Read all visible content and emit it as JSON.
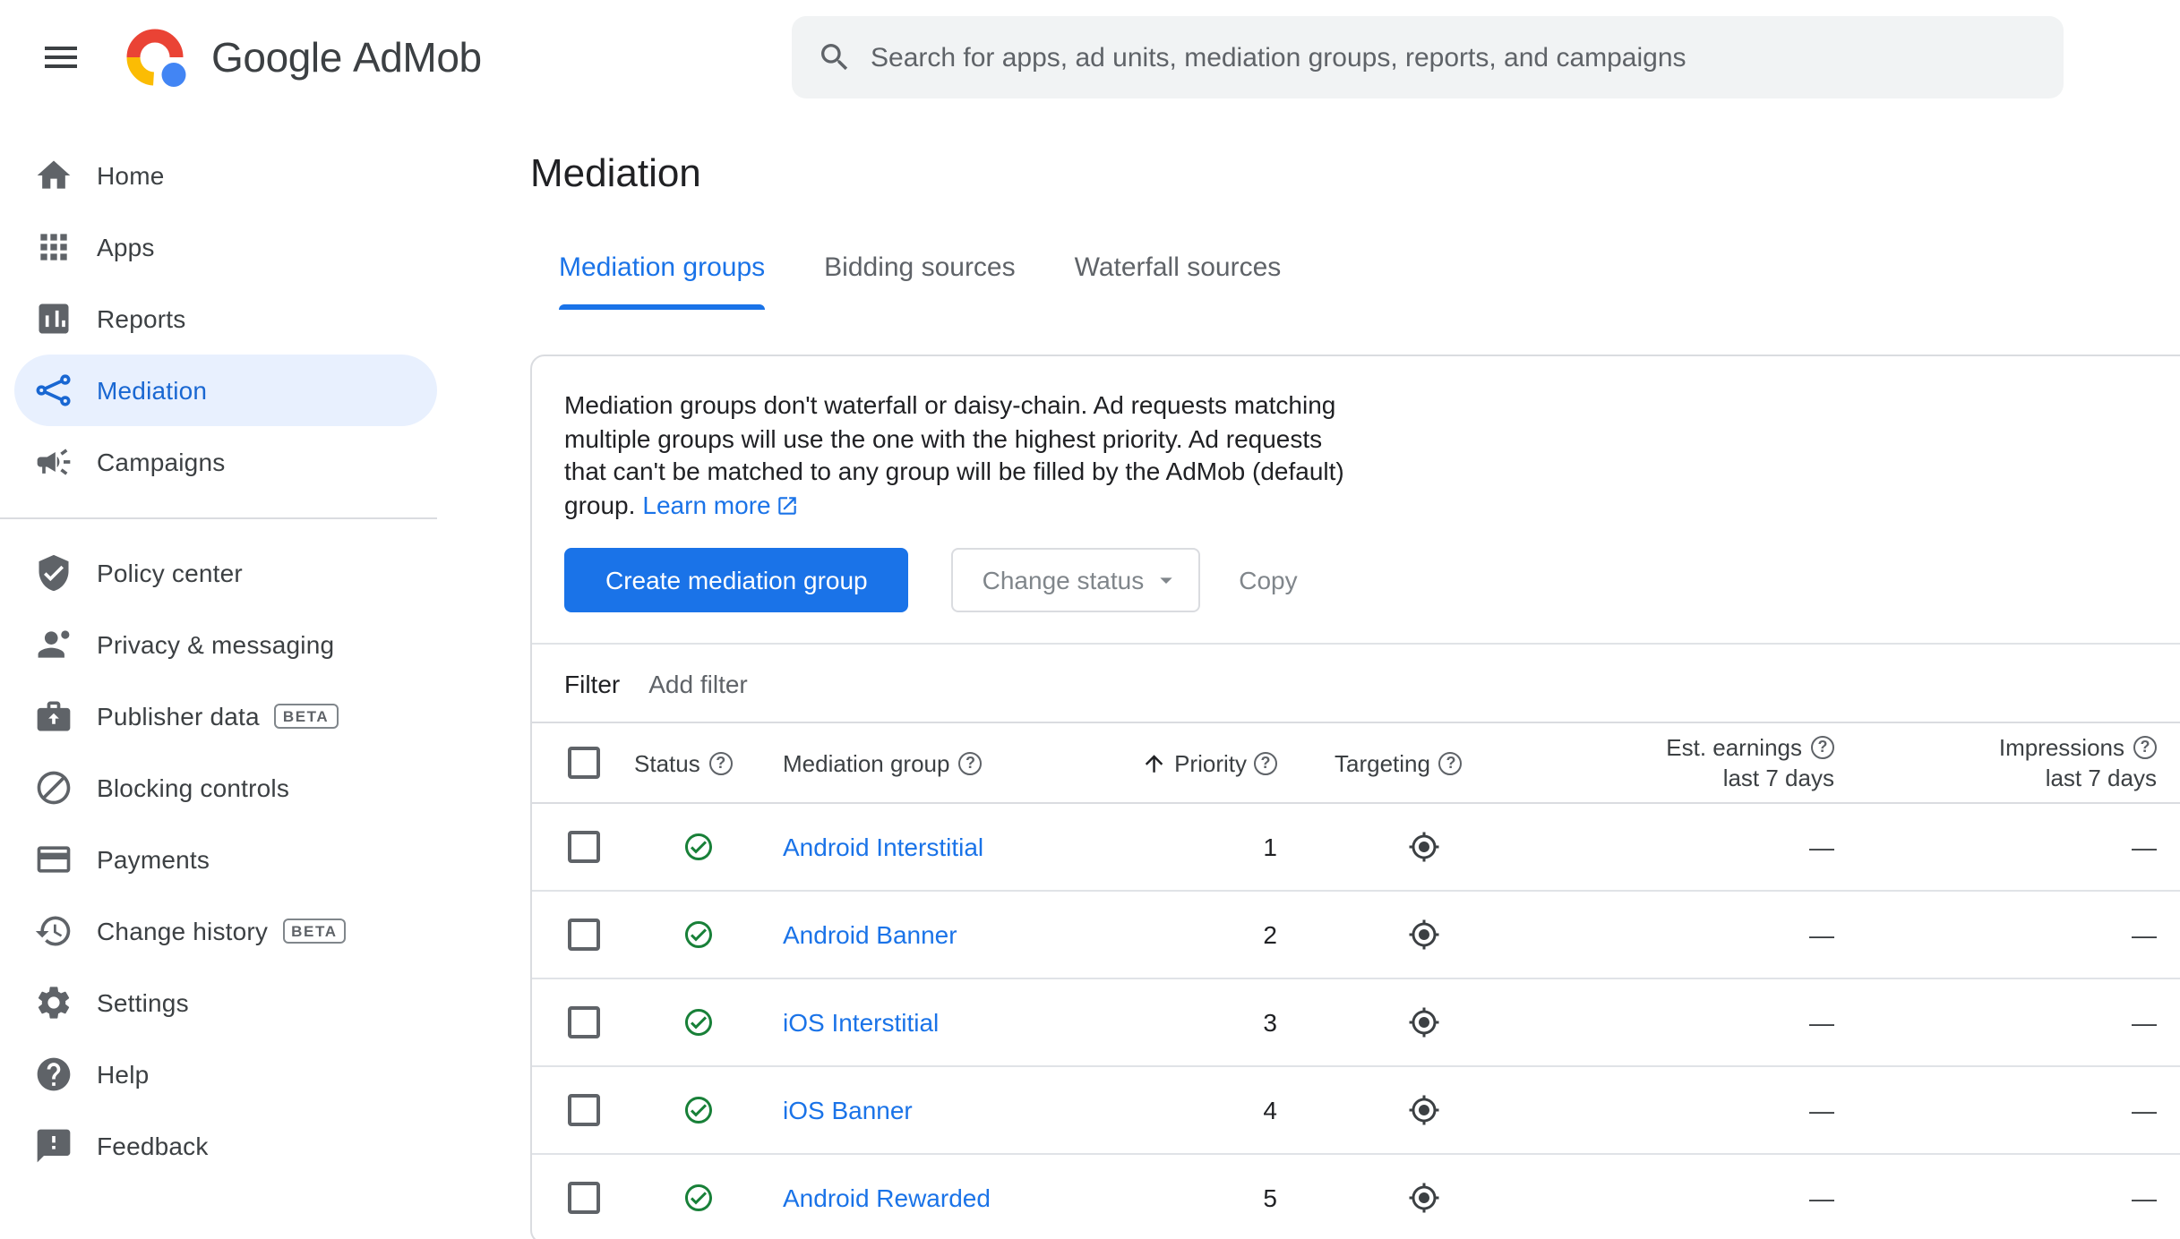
{
  "header": {
    "brand": "Google",
    "product": "AdMob",
    "search_placeholder": "Search for apps, ad units, mediation groups, reports, and campaigns"
  },
  "sidebar": {
    "items": [
      {
        "label": "Home",
        "icon": "home-icon"
      },
      {
        "label": "Apps",
        "icon": "apps-icon"
      },
      {
        "label": "Reports",
        "icon": "reports-icon"
      },
      {
        "label": "Mediation",
        "icon": "mediation-icon",
        "selected": true
      },
      {
        "label": "Campaigns",
        "icon": "campaigns-icon"
      },
      {
        "label": "Policy center",
        "icon": "policy-center-icon"
      },
      {
        "label": "Privacy & messaging",
        "icon": "privacy-messaging-icon"
      },
      {
        "label": "Publisher data",
        "icon": "publisher-data-icon",
        "badge": "BETA"
      },
      {
        "label": "Blocking controls",
        "icon": "blocking-controls-icon"
      },
      {
        "label": "Payments",
        "icon": "payments-icon"
      },
      {
        "label": "Change history",
        "icon": "change-history-icon",
        "badge": "BETA"
      },
      {
        "label": "Settings",
        "icon": "settings-icon"
      },
      {
        "label": "Help",
        "icon": "help-icon"
      },
      {
        "label": "Feedback",
        "icon": "feedback-icon"
      }
    ]
  },
  "page": {
    "title": "Mediation",
    "tabs": [
      {
        "label": "Mediation groups",
        "active": true
      },
      {
        "label": "Bidding sources",
        "active": false
      },
      {
        "label": "Waterfall sources",
        "active": false
      }
    ]
  },
  "card": {
    "description": "Mediation groups don't waterfall or daisy-chain. Ad requests matching\nmultiple groups will use the one with the highest priority. Ad requests\nthat can't be matched to any group will be filled by the AdMob (default)\ngroup.",
    "learn_more_label": "Learn more",
    "create_button": "Create mediation group",
    "change_status_button": "Change status",
    "copy_button": "Copy",
    "filter_label": "Filter",
    "add_filter_label": "Add filter"
  },
  "table": {
    "headers": {
      "status": "Status",
      "mediation_group": "Mediation group",
      "priority": "Priority",
      "targeting": "Targeting",
      "est_earnings": "Est. earnings",
      "est_earnings_sub": "last 7 days",
      "impressions": "Impressions",
      "impressions_sub": "last 7 days"
    },
    "rows": [
      {
        "status": "active",
        "name": "Android Interstitial",
        "priority": "1",
        "earnings": "—",
        "impressions": "—"
      },
      {
        "status": "active",
        "name": "Android Banner",
        "priority": "2",
        "earnings": "—",
        "impressions": "—"
      },
      {
        "status": "active",
        "name": "iOS Interstitial",
        "priority": "3",
        "earnings": "—",
        "impressions": "—"
      },
      {
        "status": "active",
        "name": "iOS Banner",
        "priority": "4",
        "earnings": "—",
        "impressions": "—"
      },
      {
        "status": "active",
        "name": "Android Rewarded",
        "priority": "5",
        "earnings": "—",
        "impressions": "—"
      }
    ]
  },
  "colors": {
    "accent_blue": "#1a73e8",
    "selected_item_bg": "#e8f0fe",
    "selected_item_text": "#1967d2",
    "status_active_green": "#188038",
    "search_bg": "#f1f3f4",
    "border": "#dadce0"
  }
}
